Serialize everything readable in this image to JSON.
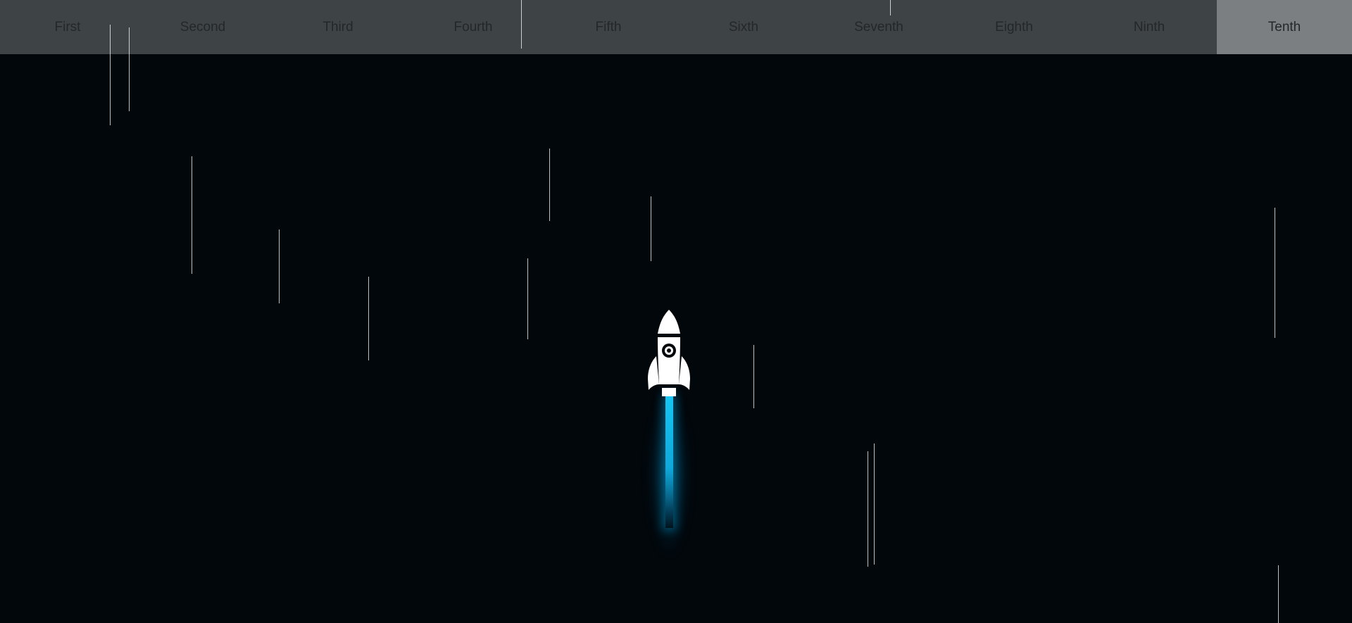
{
  "nav": {
    "tabs": [
      {
        "label": "First",
        "active": false
      },
      {
        "label": "Second",
        "active": false
      },
      {
        "label": "Third",
        "active": false
      },
      {
        "label": "Fourth",
        "active": false
      },
      {
        "label": "Fifth",
        "active": false
      },
      {
        "label": "Sixth",
        "active": false
      },
      {
        "label": "Seventh",
        "active": false
      },
      {
        "label": "Eighth",
        "active": false
      },
      {
        "label": "Ninth",
        "active": false
      },
      {
        "label": "Tenth",
        "active": true
      }
    ],
    "active_tab": "Tenth"
  },
  "scene": {
    "rocket_icon": "rocket-icon",
    "flame_color": "#16c6f3",
    "background_color": "#02070b",
    "nav_color": "#3e4346",
    "active_tab_color": "#7b7f81",
    "star_streak_color": "#ffffff"
  }
}
